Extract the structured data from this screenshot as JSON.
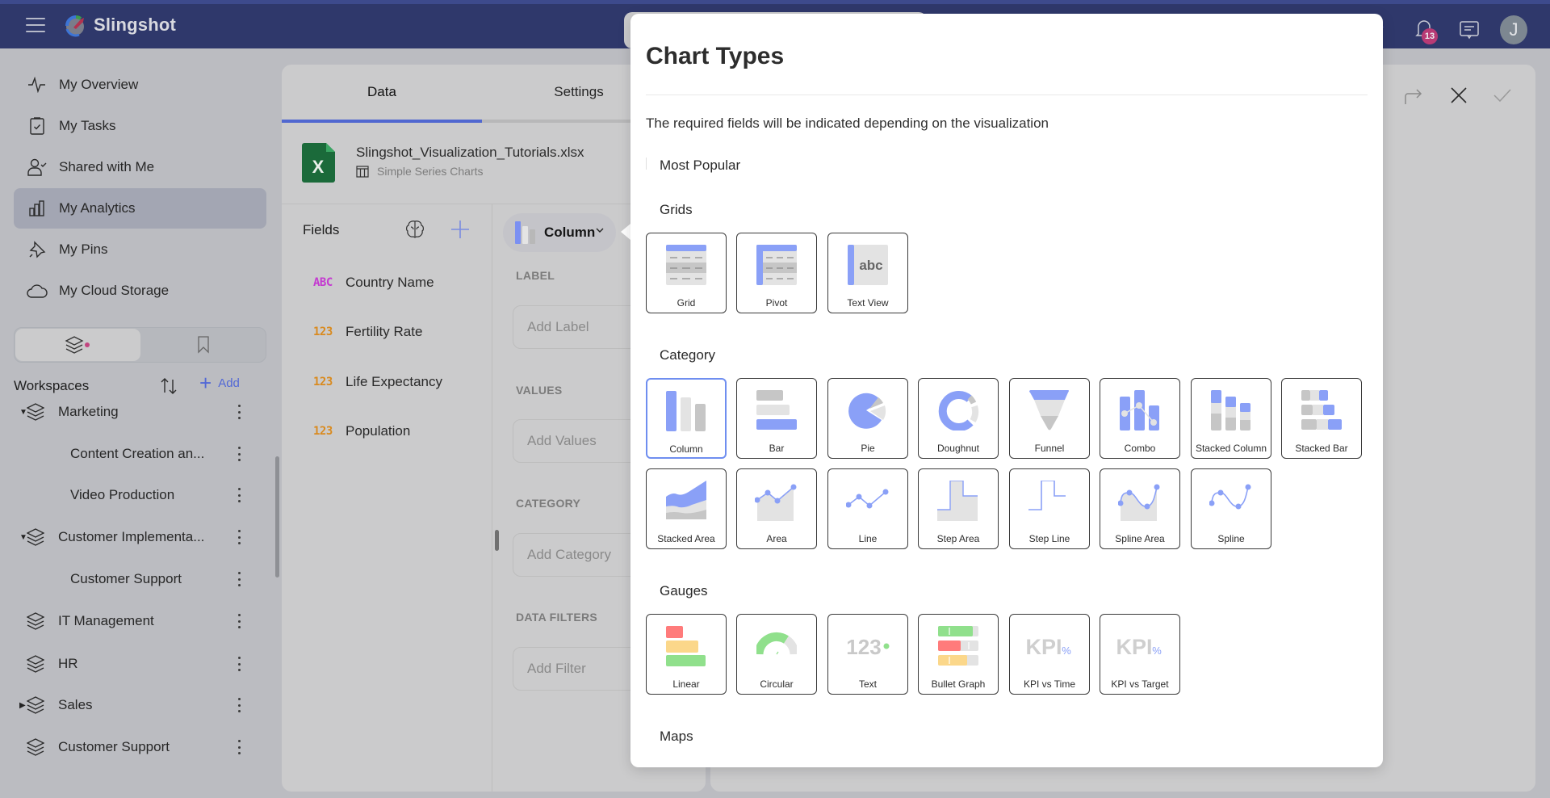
{
  "app": {
    "name": "Slingshot",
    "notifications_count": "13",
    "user_initial": "J"
  },
  "colors": {
    "brand_bar": "#2f386b",
    "accent": "#5168d0",
    "chart_blue": "#8aa0f7",
    "selected_border": "#6f8ef0",
    "badge": "#b83a75"
  },
  "sidebar": {
    "nav": [
      {
        "label": "My Overview",
        "icon": "activity-icon",
        "active": false
      },
      {
        "label": "My Tasks",
        "icon": "clipboard-check-icon",
        "active": false
      },
      {
        "label": "Shared with Me",
        "icon": "user-check-icon",
        "active": false
      },
      {
        "label": "My Analytics",
        "icon": "bar-chart-icon",
        "active": true
      },
      {
        "label": "My Pins",
        "icon": "pin-icon",
        "active": false
      },
      {
        "label": "My Cloud Storage",
        "icon": "cloud-icon",
        "active": false
      }
    ],
    "segments": [
      {
        "name": "workspaces",
        "icon": "layers-icon",
        "active": true
      },
      {
        "name": "bookmarks",
        "icon": "bookmark-icon",
        "active": false
      }
    ],
    "workspaces_title": "Workspaces",
    "add_label": "Add",
    "workspaces": [
      {
        "label": "Marketing",
        "level": 0,
        "caret": "expanded"
      },
      {
        "label": "Content Creation an...",
        "level": 1,
        "caret": "none"
      },
      {
        "label": "Video Production",
        "level": 1,
        "caret": "none"
      },
      {
        "label": "Customer Implementa...",
        "level": 0,
        "caret": "expanded"
      },
      {
        "label": "Customer Support",
        "level": 1,
        "caret": "none"
      },
      {
        "label": "IT Management",
        "level": 0,
        "caret": "none"
      },
      {
        "label": "HR",
        "level": 0,
        "caret": "none"
      },
      {
        "label": "Sales",
        "level": 0,
        "caret": "collapsed"
      },
      {
        "label": "Customer Support",
        "level": 0,
        "caret": "none"
      }
    ]
  },
  "editor": {
    "tabs": [
      {
        "label": "Data",
        "active": true
      },
      {
        "label": "Settings",
        "active": false
      }
    ],
    "file_name": "Slingshot_Visualization_Tutorials.xlsx",
    "sheet_name": "Simple Series Charts",
    "fields_title": "Fields",
    "fields": [
      {
        "type": "ABC",
        "kind": "text",
        "name": "Country Name"
      },
      {
        "type": "123",
        "kind": "num",
        "name": "Fertility Rate"
      },
      {
        "type": "123",
        "kind": "num",
        "name": "Life Expectancy"
      },
      {
        "type": "123",
        "kind": "num",
        "name": "Population"
      }
    ],
    "chart_type_selected": "Column",
    "sections": [
      {
        "title": "LABEL",
        "placeholder": "Add Label"
      },
      {
        "title": "VALUES",
        "placeholder": "Add Values"
      },
      {
        "title": "CATEGORY",
        "placeholder": "Add Category"
      },
      {
        "title": "DATA FILTERS",
        "placeholder": "Add Filter"
      }
    ]
  },
  "canvas_actions": [
    {
      "name": "redo-button",
      "icon": "redo-icon"
    },
    {
      "name": "close-button",
      "icon": "close-icon"
    },
    {
      "name": "confirm-button",
      "icon": "check-icon"
    }
  ],
  "modal": {
    "title": "Chart Types",
    "subtitle": "The required fields will be indicated depending on the visualization",
    "groups": [
      {
        "title": "Most Popular",
        "items": []
      },
      {
        "title": "Grids",
        "items": [
          {
            "label": "Grid",
            "icon": "grid-icon"
          },
          {
            "label": "Pivot",
            "icon": "pivot-icon"
          },
          {
            "label": "Text View",
            "icon": "text-view-icon",
            "glyph": "abc"
          }
        ]
      },
      {
        "title": "Category",
        "items": [
          {
            "label": "Column",
            "icon": "column-chart-icon",
            "selected": true
          },
          {
            "label": "Bar",
            "icon": "bar-chart-icon"
          },
          {
            "label": "Pie",
            "icon": "pie-chart-icon"
          },
          {
            "label": "Doughnut",
            "icon": "doughnut-chart-icon"
          },
          {
            "label": "Funnel",
            "icon": "funnel-chart-icon"
          },
          {
            "label": "Combo",
            "icon": "combo-chart-icon"
          },
          {
            "label": "Stacked Column",
            "icon": "stacked-column-icon"
          },
          {
            "label": "Stacked Bar",
            "icon": "stacked-bar-icon"
          },
          {
            "label": "Stacked Area",
            "icon": "stacked-area-icon"
          },
          {
            "label": "Area",
            "icon": "area-chart-icon"
          },
          {
            "label": "Line",
            "icon": "line-chart-icon"
          },
          {
            "label": "Step Area",
            "icon": "step-area-icon"
          },
          {
            "label": "Step Line",
            "icon": "step-line-icon"
          },
          {
            "label": "Spline Area",
            "icon": "spline-area-icon"
          },
          {
            "label": "Spline",
            "icon": "spline-chart-icon"
          }
        ]
      },
      {
        "title": "Gauges",
        "items": [
          {
            "label": "Linear",
            "icon": "linear-gauge-icon"
          },
          {
            "label": "Circular",
            "icon": "circular-gauge-icon"
          },
          {
            "label": "Text",
            "icon": "text-gauge-icon",
            "glyph": "123"
          },
          {
            "label": "Bullet Graph",
            "icon": "bullet-graph-icon"
          },
          {
            "label": "KPI vs Time",
            "icon": "kpi-time-icon",
            "glyph": "KPI",
            "suffix": "%"
          },
          {
            "label": "KPI vs Target",
            "icon": "kpi-target-icon",
            "glyph": "KPI",
            "suffix": "%"
          }
        ]
      },
      {
        "title": "Maps",
        "items": []
      }
    ]
  }
}
